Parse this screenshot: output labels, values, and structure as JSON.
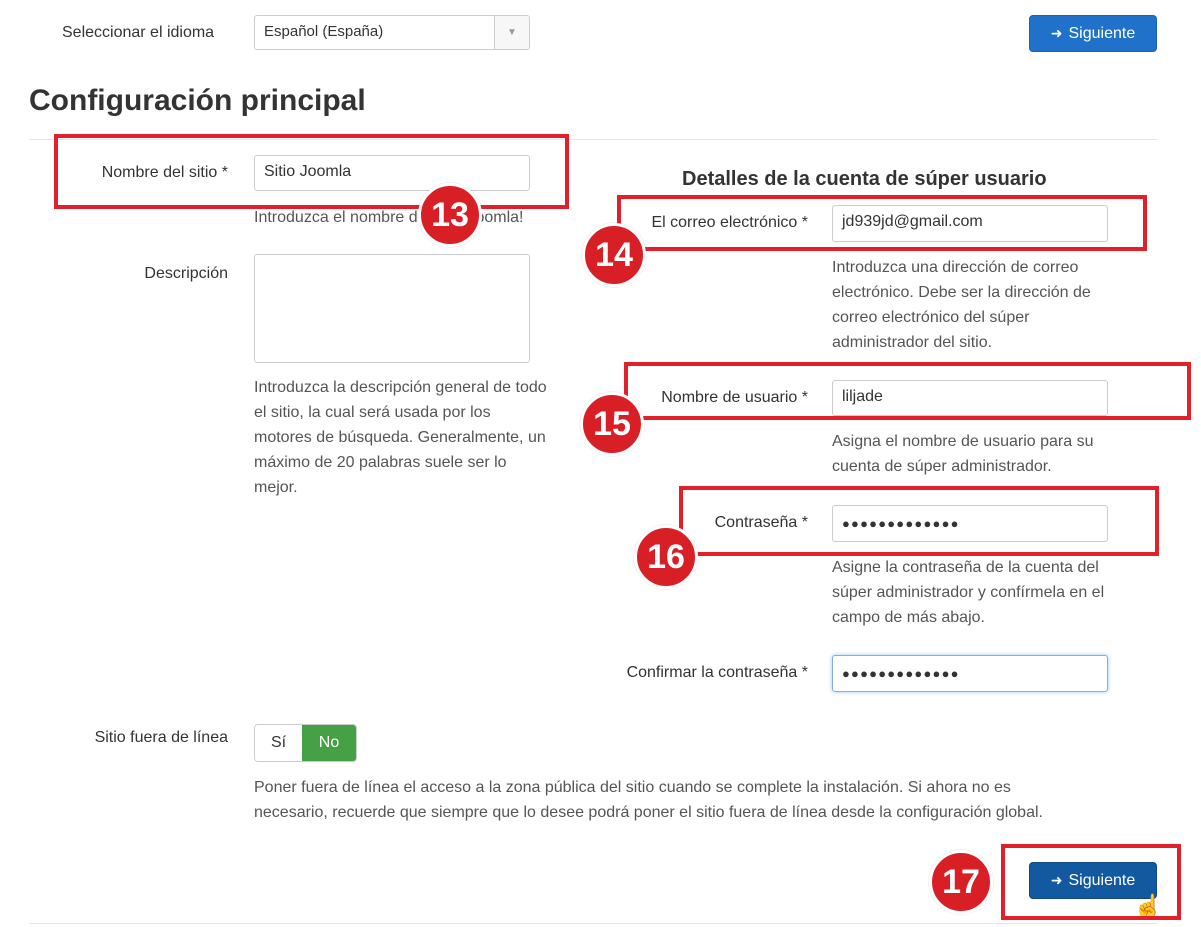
{
  "language": {
    "label": "Seleccionar el idioma",
    "value": "Español (España)"
  },
  "buttons": {
    "next_top": "Siguiente",
    "next_bottom": "Siguiente"
  },
  "main": {
    "title": "Configuración principal",
    "site_name_label": "Nombre del sitio *",
    "site_name_value": "Sitio Joomla",
    "site_name_help": "Introduzca el nombre del sitio Joomla!",
    "description_label": "Descripción",
    "description_value": "",
    "description_help": [
      "Introduzca la descripción general de todo",
      "el sitio, la cual será usada por los",
      "motores de búsqueda. Generalmente, un",
      "máximo de 20 palabras suele ser lo",
      "mejor."
    ],
    "offline_label": "Sitio fuera de línea",
    "offline_yes": "Sí",
    "offline_no": "No",
    "offline_selected": "No",
    "offline_help": [
      "Poner fuera de línea el acceso a la zona pública del sitio cuando se complete la instalación. Si ahora no es",
      "necesario, recuerde que siempre que lo desee podrá poner el sitio fuera de línea desde la configuración global."
    ]
  },
  "superuser": {
    "heading": "Detalles de la cuenta de súper usuario",
    "email_label": "El correo electrónico *",
    "email_value": "jd939jd@gmail.com",
    "email_help": [
      "Introduzca una dirección de correo",
      "electrónico. Debe ser la dirección de",
      "correo electrónico del súper",
      "administrador del sitio."
    ],
    "username_label": "Nombre de usuario *",
    "username_value": "liljade",
    "username_help": [
      "Asigna el nombre de usuario para su",
      "cuenta de súper administrador."
    ],
    "password_label": "Contraseña *",
    "password_value": "●●●●●●●●●●●●●",
    "password_help": [
      "Asigne la contraseña de la cuenta del",
      "súper administrador y confírmela en el",
      "campo de más abajo."
    ],
    "confirm_label": "Confirmar la contraseña *",
    "confirm_value": "●●●●●●●●●●●●●"
  },
  "annotations": [
    "13",
    "14",
    "15",
    "16",
    "17"
  ],
  "colors": {
    "primary": "#1f71c9",
    "annotation_red": "#e0202a",
    "toggle_active": "#46a046"
  }
}
